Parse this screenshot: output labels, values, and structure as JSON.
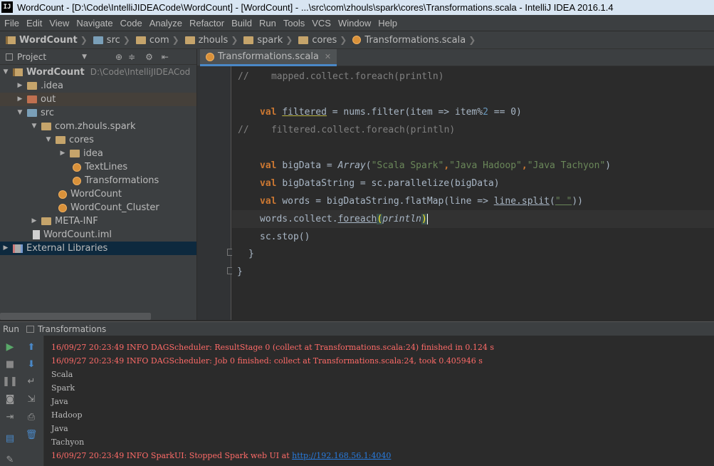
{
  "window": {
    "title": "WordCount - [D:\\Code\\IntelliJIDEACode\\WordCount] - [WordCount] - ...\\src\\com\\zhouls\\spark\\cores\\Transformations.scala - IntelliJ IDEA 2016.1.4",
    "app_icon": "IJ"
  },
  "menu": [
    "File",
    "Edit",
    "View",
    "Navigate",
    "Code",
    "Analyze",
    "Refactor",
    "Build",
    "Run",
    "Tools",
    "VCS",
    "Window",
    "Help"
  ],
  "breadcrumbs": [
    "WordCount",
    "src",
    "com",
    "zhouls",
    "spark",
    "cores",
    "Transformations.scala"
  ],
  "project_panel": {
    "title": "Project",
    "tree": [
      {
        "label": "WordCount",
        "extra": "D:\\Code\\IntelliJIDEACod"
      },
      {
        "label": ".idea"
      },
      {
        "label": "out"
      },
      {
        "label": "src"
      },
      {
        "label": "com.zhouls.spark"
      },
      {
        "label": "cores"
      },
      {
        "label": "idea"
      },
      {
        "label": "TextLines"
      },
      {
        "label": "Transformations"
      },
      {
        "label": "WordCount"
      },
      {
        "label": "WordCount_Cluster"
      },
      {
        "label": "META-INF"
      },
      {
        "label": "WordCount.iml"
      },
      {
        "label": "External Libraries"
      }
    ]
  },
  "editor": {
    "tab": "Transformations.scala",
    "lines": [
      {
        "comment": "//",
        "text": "    mapped.collect.foreach(println)"
      },
      {
        "text": ""
      },
      {
        "kw": "val",
        "name": "filtered",
        "rest": " = nums.filter(item => item%",
        "num": "2",
        "end": " == 0)"
      },
      {
        "comment": "//",
        "text": "    filtered.collect.foreach(println)"
      },
      {
        "text": ""
      },
      {
        "kw": "val",
        "name": "bigData",
        "mid": " = ",
        "it": "Array",
        "p1": "(",
        "s1": "\"Scala Spark\"",
        "c1": ",",
        "s2": "\"Java Hadoop\"",
        "c2": ",",
        "s3": "\"Java Tachyon\"",
        "p2": ")"
      },
      {
        "kw": "val",
        "name": "bigDataString",
        "rest": " = sc.parallelize(bigData)"
      },
      {
        "kw": "val",
        "name": "words",
        "rest1": " = bigDataString.flatMap(line => ",
        "u": "line.split",
        "p": "(",
        "s": "\" \"",
        "end": "))"
      },
      {
        "a": "words.collect.",
        "u": "foreach",
        "b": "(",
        "it": "println",
        "c": ")"
      },
      {
        "text": "sc.stop()"
      },
      {
        "text": "}"
      },
      {
        "text": "}"
      }
    ]
  },
  "run_panel": {
    "label": "Run",
    "config": "Transformations",
    "lines": [
      {
        "text": "16/09/27 20:23:49 INFO DAGScheduler: ResultStage 0 (collect at Transformations.scala:24) finished in 0.124 s"
      },
      {
        "text": "16/09/27 20:23:49 INFO DAGScheduler: Job 0 finished: collect at Transformations.scala:24, took 0.405946 s"
      },
      {
        "text": "Scala"
      },
      {
        "text": "Spark"
      },
      {
        "text": "Java"
      },
      {
        "text": "Hadoop"
      },
      {
        "text": "Java"
      },
      {
        "text": "Tachyon"
      },
      {
        "text": "16/09/27 20:23:49 INFO SparkUI: Stopped Spark web UI at ",
        "link": "http://192.168.56.1:4040"
      }
    ]
  }
}
